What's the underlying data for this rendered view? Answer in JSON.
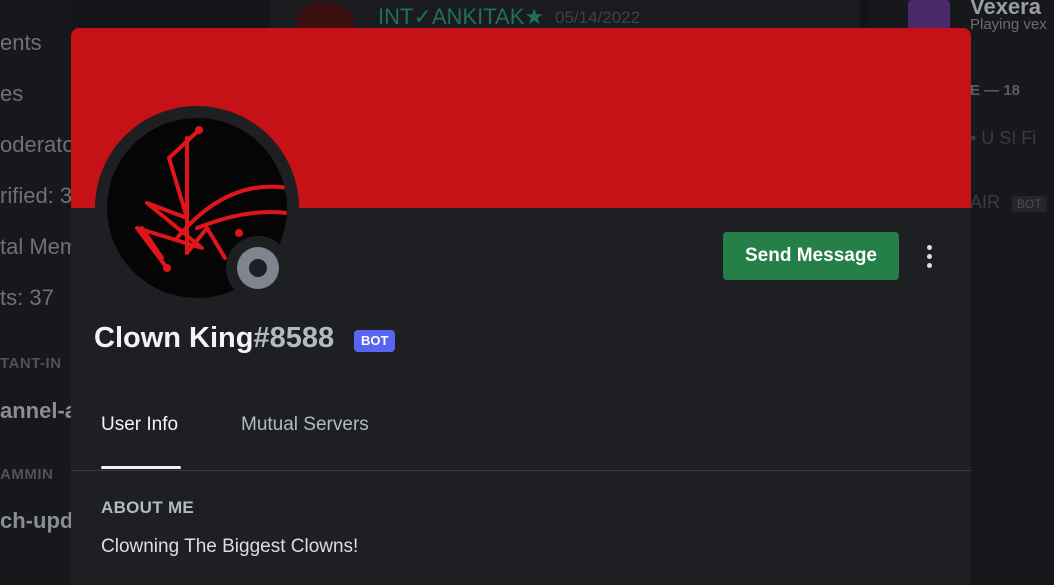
{
  "background": {
    "left_items": [
      "ents",
      "es",
      "oderato",
      "rified: 3",
      "tal Mem",
      "ts: 37"
    ],
    "left_categories": [
      "TANT-IN",
      "AMMIN"
    ],
    "left_channels": [
      "annel-a",
      "ch-upda"
    ],
    "top_message": {
      "author": "INT✓ANKITAK★",
      "date": "05/14/2022"
    },
    "right_panel": {
      "member_name": "Vexera",
      "activity": "Playing vex",
      "count_label": "E — 18",
      "faint_names": [
        "• U SI Fi",
        "AIR"
      ],
      "bot_badge": "BOT"
    }
  },
  "profile": {
    "username": "Clown King",
    "discriminator": "#8588",
    "bot_badge": "BOT",
    "banner_color": "#c61116",
    "status": "offline",
    "send_message_label": "Send Message",
    "more_icon": "more-vertical-icon",
    "tabs": [
      {
        "label": "User Info",
        "active": true
      },
      {
        "label": "Mutual Servers",
        "active": false
      }
    ],
    "about_me": {
      "title": "ABOUT ME",
      "text": "Clowning The Biggest Clowns!"
    }
  },
  "colors": {
    "send_button": "#248046",
    "bot_badge": "#5865f2",
    "modal_bg": "#1e1f22"
  }
}
